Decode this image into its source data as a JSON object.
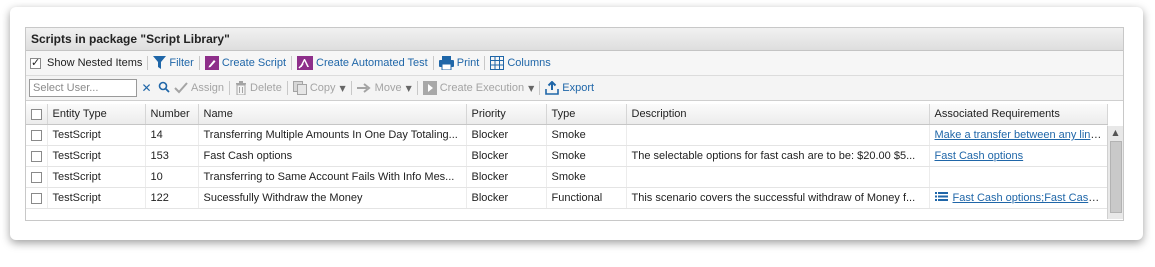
{
  "panel": {
    "title": "Scripts in package \"Script Library\""
  },
  "toolbar": {
    "show_nested_label": "Show Nested Items",
    "show_nested_checked": true,
    "filter_label": "Filter",
    "create_script_label": "Create Script",
    "create_automated_test_label": "Create Automated Test",
    "print_label": "Print",
    "columns_label": "Columns"
  },
  "actions": {
    "select_user_placeholder": "Select User...",
    "assign_label": "Assign",
    "delete_label": "Delete",
    "copy_label": "Copy",
    "move_label": "Move",
    "create_execution_label": "Create Execution",
    "export_label": "Export"
  },
  "table": {
    "columns": [
      "Entity Type",
      "Number",
      "Name",
      "Priority",
      "Type",
      "Description",
      "Associated Requirements"
    ],
    "rows": [
      {
        "entity_type": "TestScript",
        "number": "14",
        "name": "Transferring Multiple Amounts In One Day Totaling...",
        "priority": "Blocker",
        "type": "Smoke",
        "description": "",
        "requirements": "Make a transfer between any linked",
        "req_icon": false
      },
      {
        "entity_type": "TestScript",
        "number": "153",
        "name": "Fast Cash options",
        "priority": "Blocker",
        "type": "Smoke",
        "description": "The selectable options for fast cash are to be: $20.00 $5...",
        "requirements": "Fast Cash options",
        "req_icon": false
      },
      {
        "entity_type": "TestScript",
        "number": "10",
        "name": "Transferring to Same Account Fails With Info Mes...",
        "priority": "Blocker",
        "type": "Smoke",
        "description": "",
        "requirements": "",
        "req_icon": false
      },
      {
        "entity_type": "TestScript",
        "number": "122",
        "name": "Sucessfully Withdraw the Money",
        "priority": "Blocker",
        "type": "Functional",
        "description": "This scenario covers the successful withdraw of Money f...",
        "requirements": "Fast Cash options;Fast Cash op",
        "req_icon": true
      }
    ]
  },
  "colors": {
    "link": "#1f66a8",
    "create_icon": "#8e2f8a",
    "filter_icon": "#1f66a8"
  }
}
